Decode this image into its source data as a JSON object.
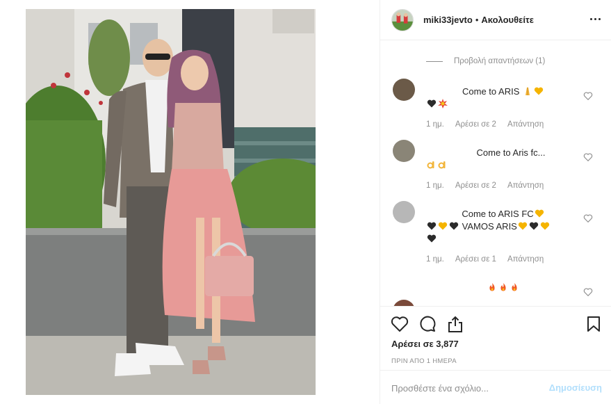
{
  "header": {
    "username": "miki33jevto",
    "separator": "•",
    "follow_status": "Ακολουθείτε"
  },
  "comments": {
    "view_replies": "Προβολή απαντήσεων (1)",
    "items": [
      {
        "text_line1": "Come to ARIS",
        "emoji_line1": [
          "folded-hands-emoji",
          "yellow-heart-emoji"
        ],
        "emoji_line2": [
          "black-heart-emoji",
          "collision-emoji"
        ],
        "time": "1 ημ.",
        "likes": "Αρέσει σε 2",
        "reply": "Απάντηση"
      },
      {
        "text_line1": "Come to Aris fc...",
        "emoji_line2": [
          "ok-hand-emoji",
          "ok-hand-emoji"
        ],
        "time": "1 ημ.",
        "likes": "Αρέσει σε 2",
        "reply": "Απάντηση"
      },
      {
        "text_line1": "Come to ARIS FC",
        "emoji_line1": [
          "yellow-heart-emoji"
        ],
        "text_line2": "VAMOS ARIS",
        "emoji_line2_before": [
          "black-heart-emoji",
          "yellow-heart-emoji",
          "black-heart-emoji"
        ],
        "emoji_line2_after": [
          "yellow-heart-emoji",
          "black-heart-emoji",
          "yellow-heart-emoji"
        ],
        "emoji_line3": [
          "black-heart-emoji"
        ],
        "time": "1 ημ.",
        "likes": "Αρέσει σε 1",
        "reply": "Απάντηση"
      },
      {
        "emoji_line1": [
          "fire-emoji",
          "fire-emoji",
          "fire-emoji"
        ]
      }
    ]
  },
  "actions": {
    "icons": [
      "heart-icon",
      "comment-icon",
      "share-icon",
      "bookmark-icon"
    ],
    "likes_count": "Αρέσει σε 3,877",
    "time_ago": "ΠΡΙΝ ΑΠΟ 1 ΗΜΕΡΑ"
  },
  "add_comment": {
    "placeholder": "Προσθέστε ένα σχόλιο...",
    "post_label": "Δημοσίευση"
  },
  "colors": {
    "text": "#262626",
    "muted": "#8e8e8e",
    "border": "#efefef",
    "post_disabled": "#b2dffc",
    "yellow_heart": "#f5b400",
    "black_heart": "#2b2b2b"
  }
}
